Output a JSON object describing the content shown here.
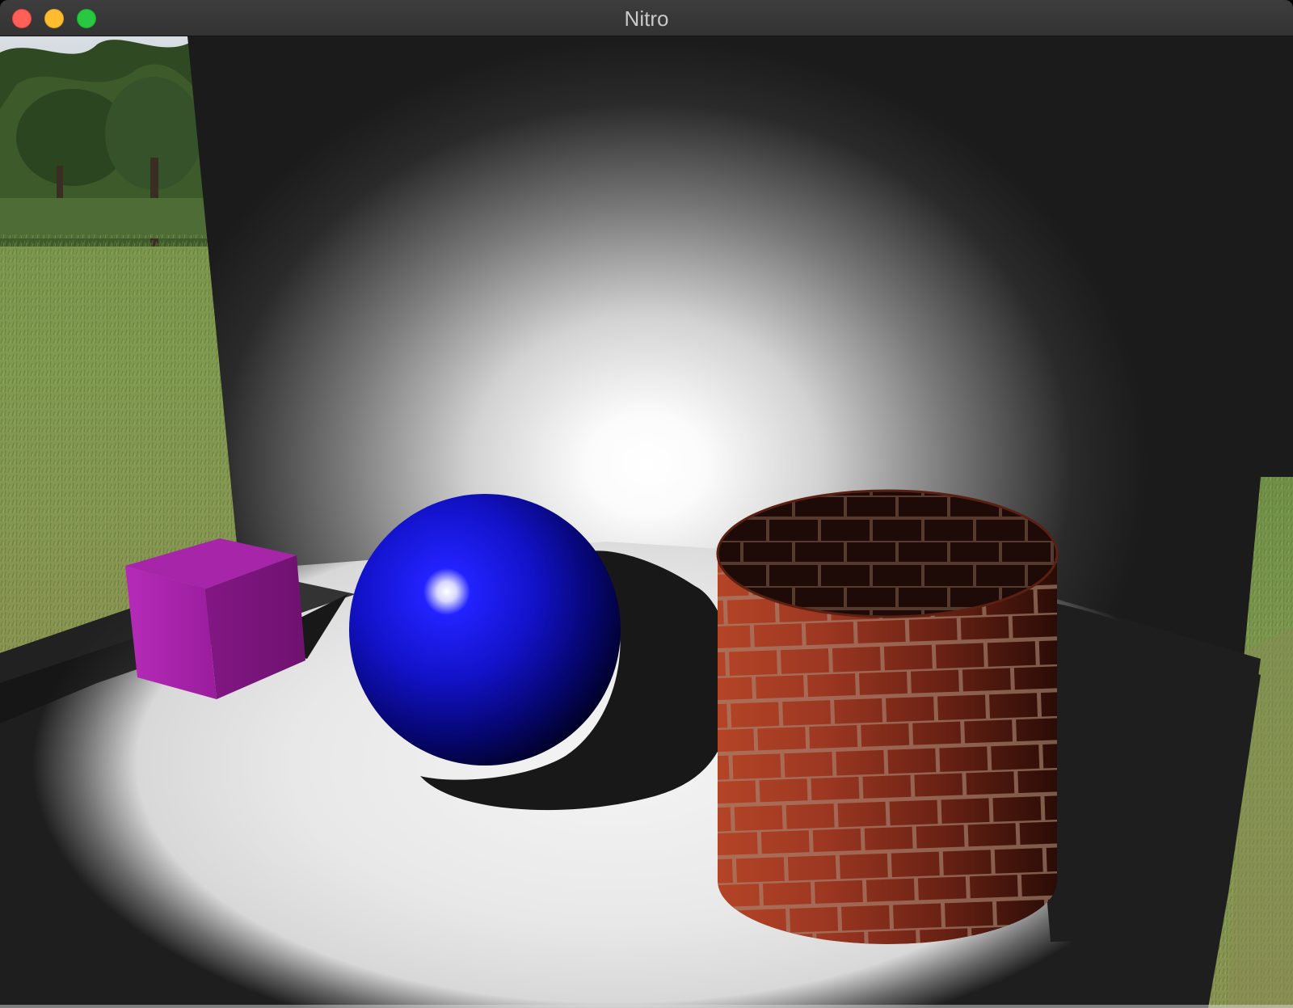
{
  "window": {
    "title": "Nitro"
  },
  "scene": {
    "objects": [
      {
        "name": "cube",
        "color": "#a51ea8"
      },
      {
        "name": "sphere",
        "color": "#1818f0"
      },
      {
        "name": "cylinder",
        "texture": "brick",
        "color": "#a33d24",
        "mortar_color": "#a88470"
      }
    ],
    "backdrop": "park-photo",
    "spotlight_color": "#ffffff",
    "wall_color": "#1b1b1b"
  }
}
